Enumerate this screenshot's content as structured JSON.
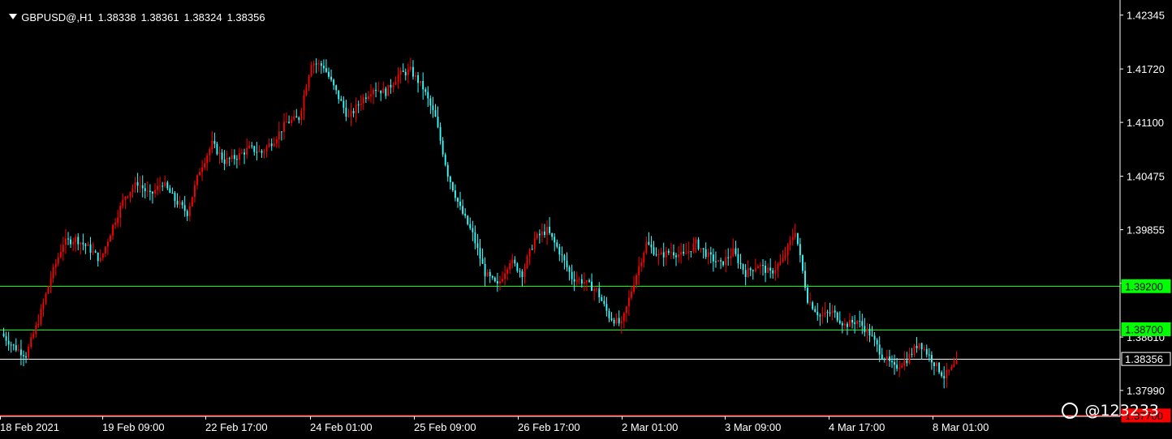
{
  "header": {
    "symbol": "GBPUSD@,H1",
    "open": "1.38338",
    "high": "1.38361",
    "low": "1.38324",
    "close": "1.38356"
  },
  "watermark": "@123233",
  "colors": {
    "background": "#000000",
    "bull": "#ff0000",
    "bear": "#33ffff",
    "axis": "#ffffff",
    "level_line": "#00ff00",
    "current_price_line": "#ffffff",
    "bottom_line": "#ff0000"
  },
  "chart_data": {
    "type": "candlestick",
    "title": "GBPUSD@,H1",
    "ylim": [
      1.3769,
      1.4252
    ],
    "y_ticks": [
      "1.42345",
      "1.41720",
      "1.41100",
      "1.40475",
      "1.39855",
      "1.39235",
      "1.38610",
      "1.37990"
    ],
    "x_ticks": [
      "18 Feb 2021",
      "19 Feb 09:00",
      "22 Feb 17:00",
      "24 Feb 01:00",
      "25 Feb 09:00",
      "26 Feb 17:00",
      "2 Mar 01:00",
      "3 Mar 09:00",
      "4 Mar 17:00",
      "8 Mar 01:00"
    ],
    "price_levels": [
      {
        "price": 1.392,
        "label": "1.39200",
        "color": "#00ff00"
      },
      {
        "price": 1.387,
        "label": "1.38700",
        "color": "#00ff00"
      },
      {
        "price": 1.38356,
        "label": "1.38356",
        "color": "#ffffff"
      },
      {
        "price": 1.377,
        "label": "1.37700",
        "color": "#ff0000"
      }
    ],
    "close_path": [
      1.3865,
      1.385,
      1.384,
      1.388,
      1.393,
      1.397,
      1.3975,
      1.3965,
      1.395,
      1.399,
      1.4025,
      1.404,
      1.4025,
      1.404,
      1.402,
      1.4005,
      1.4055,
      1.4085,
      1.4065,
      1.407,
      1.408,
      1.4075,
      1.409,
      1.411,
      1.4115,
      1.418,
      1.4175,
      1.4145,
      1.4115,
      1.4135,
      1.415,
      1.4145,
      1.4165,
      1.417,
      1.415,
      1.4115,
      1.405,
      1.401,
      1.398,
      1.3935,
      1.392,
      1.395,
      1.3935,
      1.3975,
      1.3985,
      1.396,
      1.393,
      1.3925,
      1.3915,
      1.3885,
      1.3875,
      1.3925,
      1.397,
      1.3955,
      1.396,
      1.3955,
      1.397,
      1.3955,
      1.3945,
      1.396,
      1.3935,
      1.3945,
      1.3935,
      1.395,
      1.3985,
      1.3905,
      1.3885,
      1.389,
      1.3875,
      1.388,
      1.3865,
      1.384,
      1.3825,
      1.3835,
      1.3855,
      1.3835,
      1.3815,
      1.383
    ]
  }
}
